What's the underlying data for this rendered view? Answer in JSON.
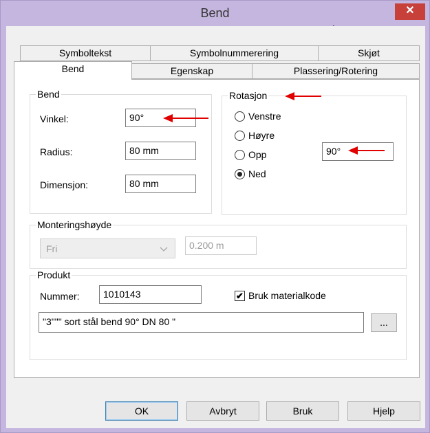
{
  "window": {
    "title": "Bend",
    "close_glyph": "✕"
  },
  "tabs_row1": [
    "Symboltekst",
    "Symbolnummerering",
    "Skjøt"
  ],
  "tabs_row2": [
    "Bend",
    "Egenskap",
    "Plassering/Rotering"
  ],
  "active_tab": "Bend",
  "bend_group": {
    "title": "Bend",
    "vinkel_label": "Vinkel:",
    "vinkel_value": "90°",
    "radius_label": "Radius:",
    "radius_value": "80 mm",
    "dimensjon_label": "Dimensjon:",
    "dimensjon_value": "80 mm"
  },
  "rotasjon_group": {
    "title": "Rotasjon",
    "options": [
      "Venstre",
      "Høyre",
      "Opp",
      "Ned"
    ],
    "selected": "Ned",
    "opp_value": "90°"
  },
  "montering_group": {
    "title": "Monteringshøyde",
    "combo_value": "Fri",
    "height_value": "0.200 m"
  },
  "produkt_group": {
    "title": "Produkt",
    "nummer_label": "Nummer:",
    "nummer_value": "1010143",
    "bruk_materialkode_label": "Bruk materialkode",
    "bruk_materialkode_checked": true,
    "description_value": "\"3\"\"\"  sort stål bend 90° DN 80      \"",
    "browse_label": "..."
  },
  "buttons": {
    "ok": "OK",
    "avbryt": "Avbryt",
    "bruk": "Bruk",
    "hjelp": "Hjelp"
  },
  "colors": {
    "titlebar": "#c5b6df",
    "close": "#c7403a",
    "arrow": "#e00000"
  }
}
